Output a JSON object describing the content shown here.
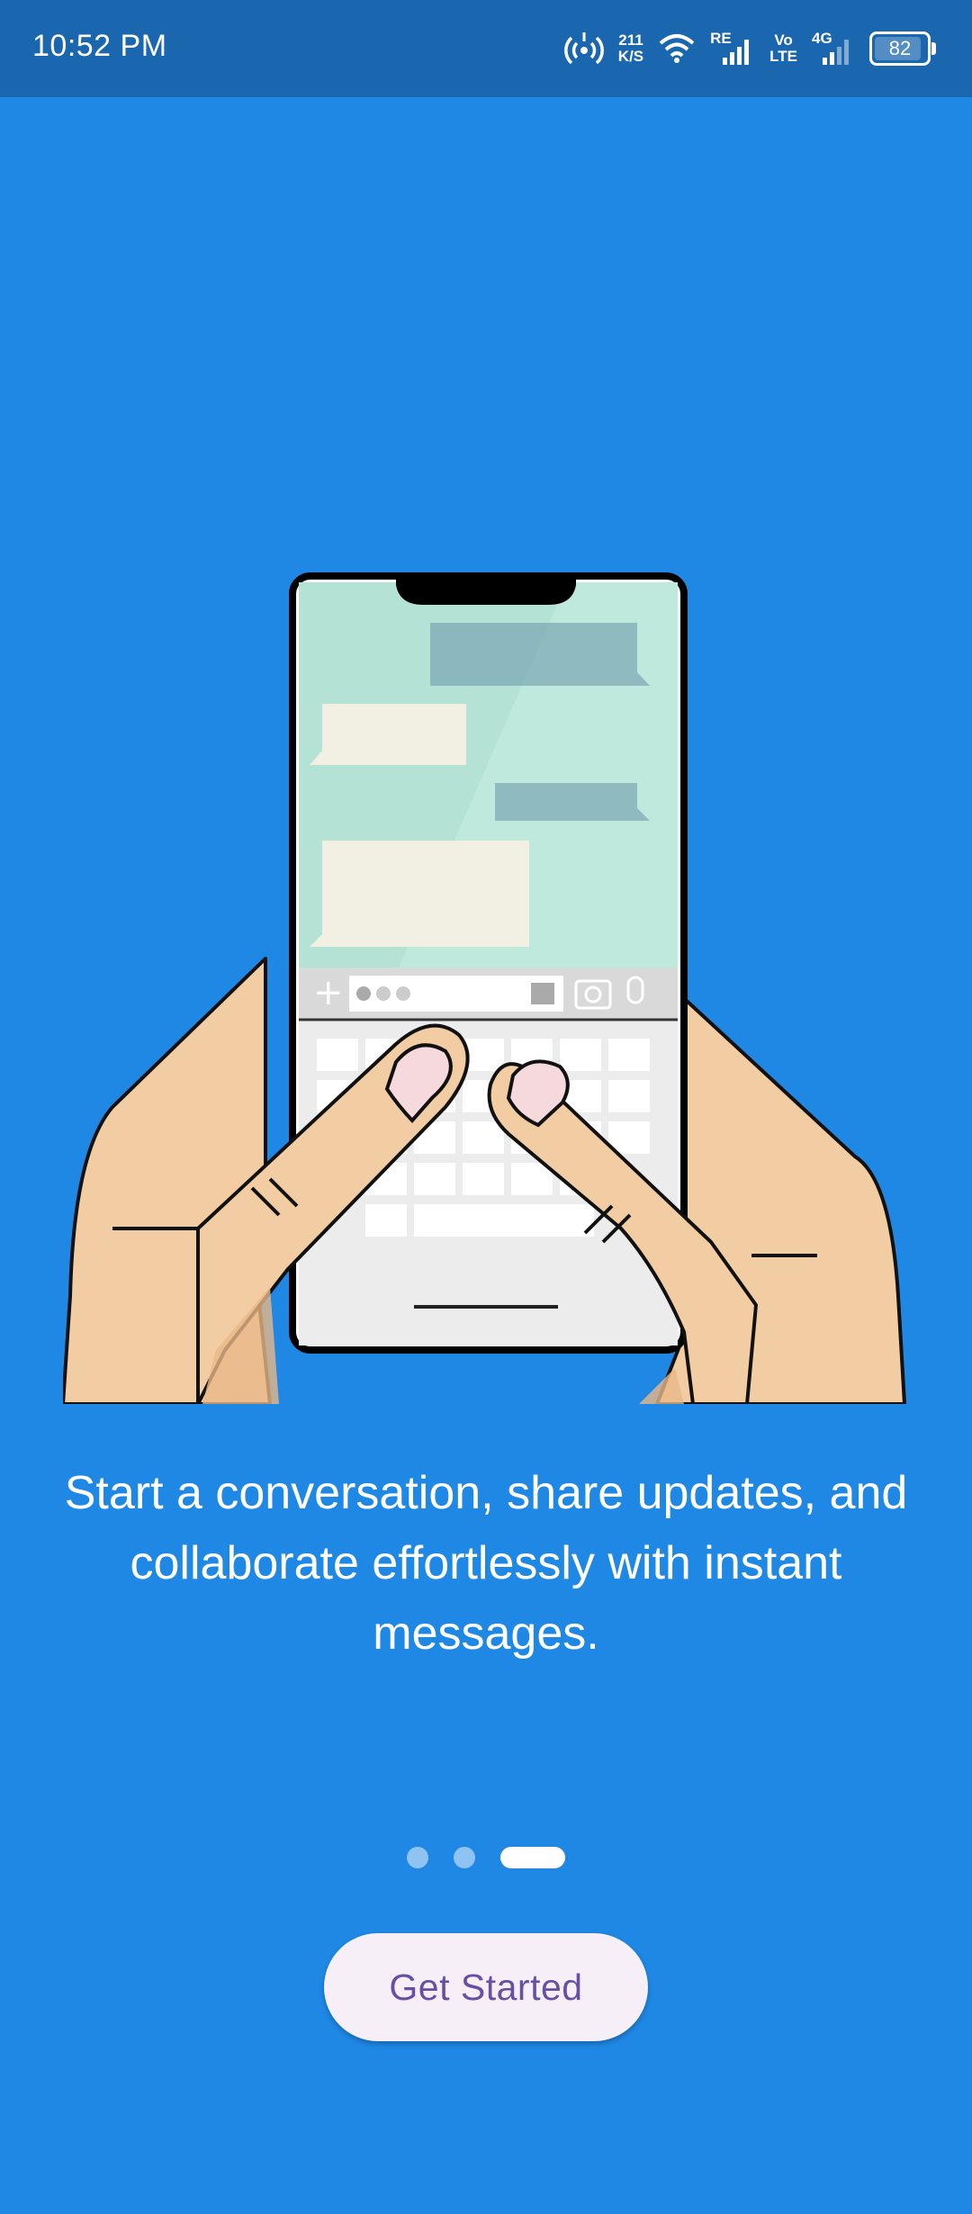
{
  "status_bar": {
    "time": "10:52 PM",
    "speed_value": "211",
    "speed_unit": "K/S",
    "sim1_label": "RE",
    "volte_top": "Vo",
    "volte_bottom": "LTE",
    "network_label": "4G",
    "battery": "82"
  },
  "onboarding": {
    "message": "Start a conversation, share updates, and collaborate effortlessly with instant messages.",
    "page_count": 3,
    "active_page": 3
  },
  "actions": {
    "get_started_label": "Get Started"
  },
  "colors": {
    "background": "#1f88e5",
    "status_bar": "#1a67b0",
    "button_background": "#f6eff7",
    "button_text": "#6750a4"
  }
}
